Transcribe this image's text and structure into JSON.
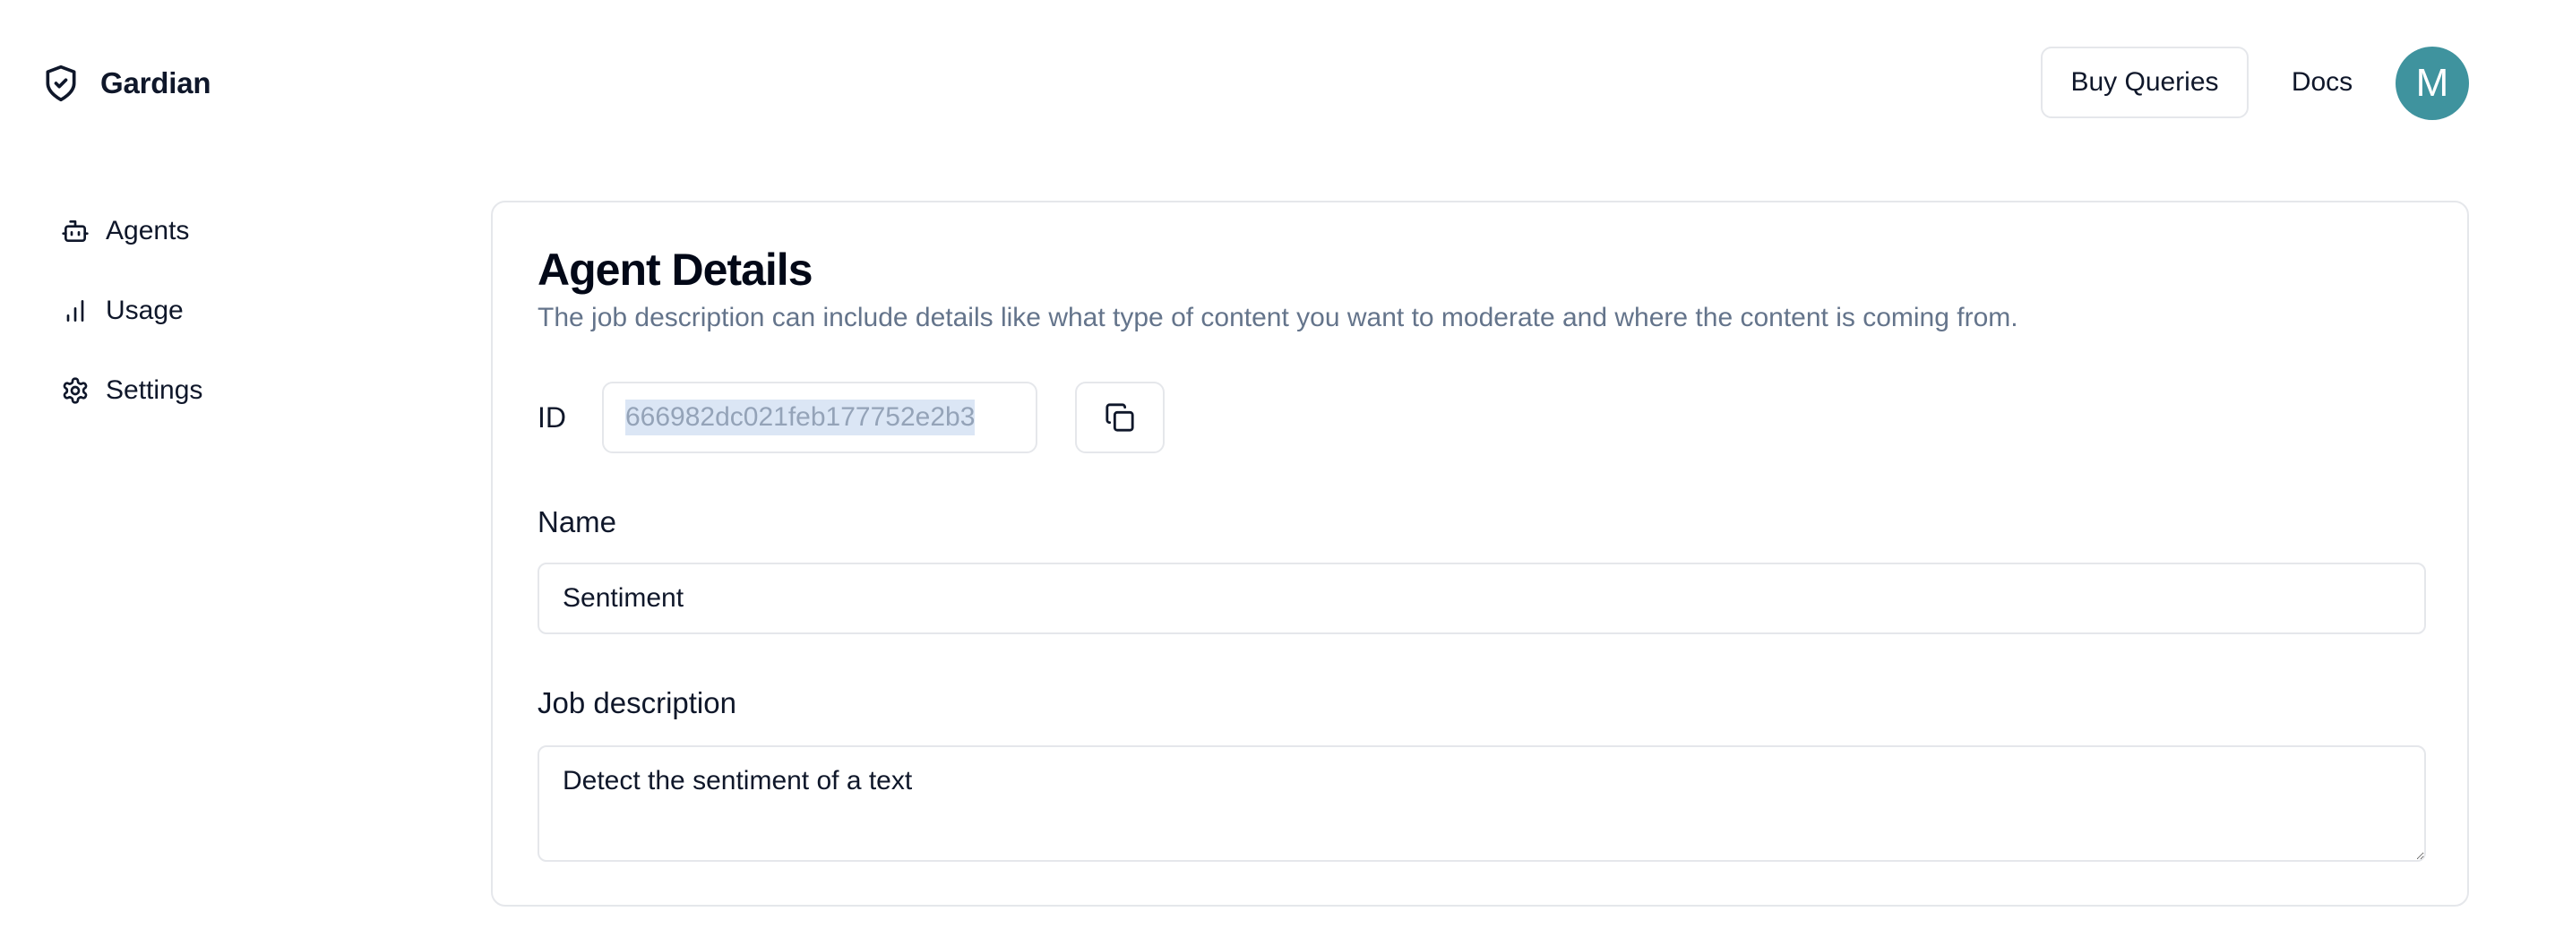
{
  "header": {
    "brand_name": "Gardian",
    "buy_queries_label": "Buy Queries",
    "docs_label": "Docs",
    "avatar_initial": "M",
    "avatar_color": "#3f939e"
  },
  "sidebar": {
    "items": [
      {
        "label": "Agents",
        "icon": "robot-icon"
      },
      {
        "label": "Usage",
        "icon": "bar-chart-icon"
      },
      {
        "label": "Settings",
        "icon": "gear-icon"
      }
    ]
  },
  "agent": {
    "title": "Agent Details",
    "description": "The job description can include details like what type of content you want to moderate and where the content is coming from.",
    "id_label": "ID",
    "id_value": "666982dc021feb177752e2b3",
    "copy_icon": "copy-icon",
    "name_label": "Name",
    "name_value": "Sentiment",
    "job_label": "Job description",
    "job_value": "Detect the sentiment of a text"
  }
}
